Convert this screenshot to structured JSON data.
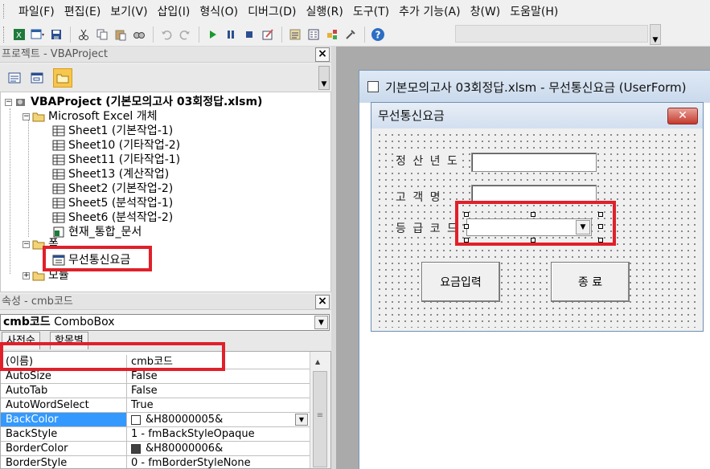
{
  "menubar": {
    "items": [
      "파일(F)",
      "편집(E)",
      "보기(V)",
      "삽입(I)",
      "형식(O)",
      "디버그(D)",
      "실행(R)",
      "도구(T)",
      "추가 기능(A)",
      "창(W)",
      "도움말(H)"
    ]
  },
  "toolbar": {
    "icons": [
      "excel-icon",
      "insert-userform-icon",
      "save-icon",
      "cut-icon",
      "copy-icon",
      "paste-icon",
      "find-icon",
      "undo-icon",
      "redo-icon",
      "run-icon",
      "break-icon",
      "reset-icon",
      "design-mode-icon",
      "project-explorer-icon",
      "properties-icon",
      "object-browser-icon",
      "toolbox-icon",
      "help-icon"
    ]
  },
  "project_pane": {
    "title": "프로젝트 - VBAProject",
    "close": "×",
    "tree": {
      "root": "VBAProject (기본모의고사 03회정답.xlsm)",
      "folder_excel": "Microsoft Excel 개체",
      "sheets": [
        "Sheet1 (기본작업-1)",
        "Sheet10 (기타작업-2)",
        "Sheet11 (기타작업-1)",
        "Sheet13 (계산작업)",
        "Sheet2 (기본작업-2)",
        "Sheet5 (분석작업-1)",
        "Sheet6 (분석작업-2)"
      ],
      "workbook": "현재_통합_문서",
      "folder_forms": "폼",
      "form_item": "무선통신요금",
      "folder_modules": "모듈"
    }
  },
  "properties_pane": {
    "title": "속성 - cmb코드",
    "close": "×",
    "object_name": "cmb코드",
    "object_type": "ComboBox",
    "tabs": [
      "사전순",
      "항목별"
    ],
    "rows": [
      {
        "name": "(이름)",
        "value": "cmb코드"
      },
      {
        "name": "AutoSize",
        "value": "False"
      },
      {
        "name": "AutoTab",
        "value": "False"
      },
      {
        "name": "AutoWordSelect",
        "value": "True"
      },
      {
        "name": "BackColor",
        "value": "&H80000005&"
      },
      {
        "name": "BackStyle",
        "value": "1 - fmBackStyleOpaque"
      },
      {
        "name": "BorderColor",
        "value": "&H80000006&"
      },
      {
        "name": "BorderStyle",
        "value": "0 - fmBorderStyleNone"
      }
    ],
    "colors": {
      "backcolor_swatch": "#ffffff",
      "bordercolor_swatch": "#404040",
      "selection": "#3399ff"
    }
  },
  "designer": {
    "title": "기본모의고사 03회정답.xlsm - 무선통신요금 (UserForm)",
    "form": {
      "caption": "무선통신요금",
      "close": "✕",
      "labels": [
        "정 산 년 도",
        "고 객 명",
        "등 급 코 드"
      ],
      "buttons": [
        "요금입력",
        "종  료"
      ]
    }
  },
  "highlight_color": "#e0202a"
}
